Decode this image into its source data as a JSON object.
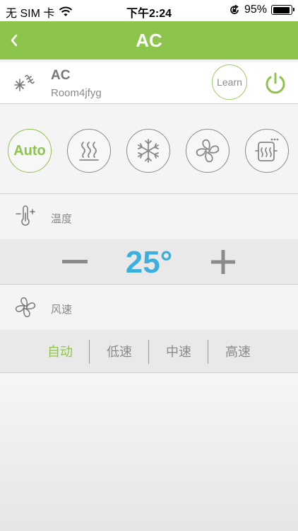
{
  "status_bar": {
    "carrier": "无 SIM 卡",
    "time": "下午2:24",
    "battery_text": "95%",
    "battery_level": 0.95,
    "icons": [
      "wifi-icon",
      "orientation-lock-icon",
      "battery-icon"
    ]
  },
  "nav": {
    "title": "AC",
    "back_icon": "chevron-left-icon"
  },
  "device": {
    "name": "AC",
    "room": "Room4jfyg",
    "learn_label": "Learn",
    "icon": "ac-unit-icon",
    "power_icon": "power-icon"
  },
  "modes": {
    "items": [
      {
        "id": "auto",
        "label": "Auto",
        "icon": "auto-mode",
        "active": true
      },
      {
        "id": "heat",
        "label": "",
        "icon": "heat-icon",
        "active": false
      },
      {
        "id": "cool",
        "label": "",
        "icon": "snowflake-icon",
        "active": false
      },
      {
        "id": "fan",
        "label": "",
        "icon": "fan-icon",
        "active": false
      },
      {
        "id": "dry",
        "label": "",
        "icon": "dehumidify-icon",
        "active": false
      }
    ]
  },
  "temperature": {
    "label": "温度",
    "value": "25°",
    "icon": "thermometer-icon"
  },
  "fan_speed": {
    "label": "风速",
    "icon": "fan-icon",
    "options": [
      "自动",
      "低速",
      "中速",
      "高速"
    ],
    "selected": "自动"
  },
  "colors": {
    "accent": "#8dc44b",
    "temperature": "#3ab0e0",
    "text_gray": "#8a8a8a"
  }
}
